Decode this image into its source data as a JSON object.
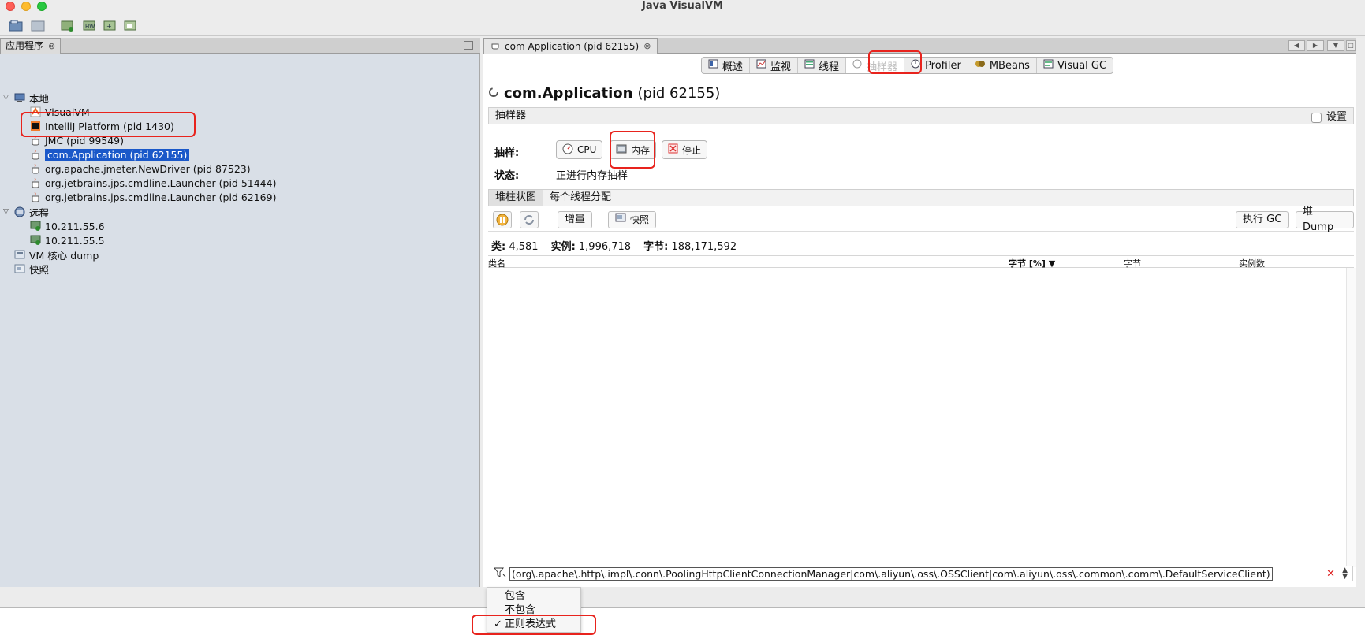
{
  "window": {
    "title": "Java VisualVM"
  },
  "left_panel": {
    "tab_label": "应用程序",
    "tree": [
      {
        "label": "本地",
        "icon": "computer-icon"
      },
      {
        "label": "VisualVM",
        "icon": "visualvm-icon"
      },
      {
        "label": "IntelliJ Platform (pid 1430)",
        "icon": "intellij-icon"
      },
      {
        "label": "JMC (pid 99549)",
        "icon": "java-cup-icon"
      },
      {
        "label": "com.Application (pid 62155)",
        "icon": "java-cup-icon",
        "selected": true
      },
      {
        "label": "org.apache.jmeter.NewDriver (pid 87523)",
        "icon": "java-cup-icon"
      },
      {
        "label": "org.jetbrains.jps.cmdline.Launcher (pid 51444)",
        "icon": "java-cup-icon"
      },
      {
        "label": "org.jetbrains.jps.cmdline.Launcher (pid 62169)",
        "icon": "java-cup-icon"
      },
      {
        "label": "远程",
        "icon": "remote-hosts-icon"
      },
      {
        "label": "10.211.55.6",
        "icon": "remote-host-icon"
      },
      {
        "label": "10.211.55.5",
        "icon": "remote-host-icon"
      },
      {
        "label": "VM 核心 dump",
        "icon": "core-dump-icon"
      },
      {
        "label": "快照",
        "icon": "snapshot-icon"
      }
    ]
  },
  "right_panel": {
    "doc_tab_label": "com Application (pid 62155)",
    "view_tabs": [
      {
        "label": "概述",
        "icon": "overview-icon"
      },
      {
        "label": "监视",
        "icon": "monitor-icon"
      },
      {
        "label": "线程",
        "icon": "threads-icon"
      },
      {
        "label": "抽样器",
        "icon": "sampler-icon",
        "active": true
      },
      {
        "label": "Profiler",
        "icon": "profiler-icon"
      },
      {
        "label": "MBeans",
        "icon": "mbeans-icon"
      },
      {
        "label": "Visual GC",
        "icon": "visual-gc-icon"
      }
    ],
    "heading_name": "com.Application",
    "heading_pid": "(pid 62155)",
    "sampler_section_title": "抽样器",
    "settings_label": "设置",
    "sample_label": "抽样:",
    "buttons": {
      "cpu": "CPU",
      "memory": "内存",
      "stop": "停止"
    },
    "status_label": "状态:",
    "status_value": "正进行内存抽样",
    "sub_tabs": [
      "堆柱状图",
      "每个线程分配"
    ],
    "actions": {
      "delta": "增量",
      "snapshot": "快照",
      "gc": "执行 GC",
      "heap_dump": "堆 Dump"
    },
    "stats": {
      "classes_label": "类:",
      "classes_value": "4,581",
      "instances_label": "实例:",
      "instances_value": "1,996,718",
      "bytes_label": "字节:",
      "bytes_value": "188,171,592"
    },
    "columns": [
      "类名",
      "字节 [%]",
      "字节",
      "实例数"
    ],
    "filter_text": "(org\\.apache\\.http\\.impl\\.conn\\.PoolingHttpClientConnectionManager|com\\.aliyun\\.oss\\.OSSClient|com\\.aliyun\\.oss\\.common\\.comm\\.DefaultServiceClient)"
  },
  "popup": {
    "items": [
      {
        "label": "包含",
        "checked": false
      },
      {
        "label": "不包含",
        "checked": false
      },
      {
        "label": "正则表达式",
        "checked": true
      }
    ]
  },
  "colors": {
    "selection": "#1a58c9",
    "highlight_box": "#e8231d",
    "left_bg": "#d9dfe7"
  }
}
